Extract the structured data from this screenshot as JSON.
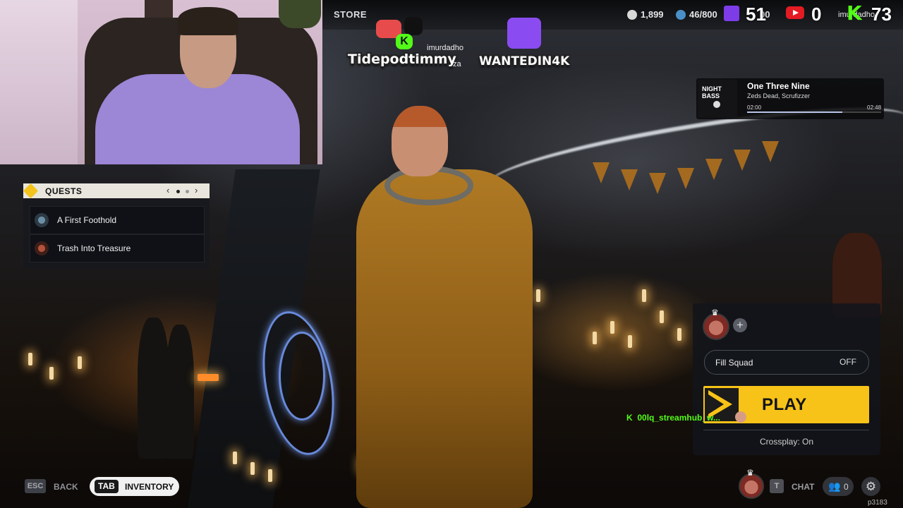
{
  "topbar": {
    "store_label": "STORE",
    "coins": "1,899",
    "capacity": "46/800",
    "hidden_value": "00",
    "twitch_viewers": "51",
    "youtube_viewers": "0",
    "kick_viewers": "73",
    "kick_username": "imurdadho"
  },
  "overlay": {
    "username_left": "Tidepodtimmy",
    "username_mid": "imurdadho",
    "username_mid_tail": "za",
    "username_right": "WANTEDIN4K"
  },
  "music": {
    "album_label": "NIGHT BASS",
    "title": "One Three Nine",
    "artist": "Zeds Dead, Scrufizzer",
    "time_current": "02:00",
    "time_total": "02:48",
    "progress": 0.71
  },
  "quests": {
    "title": "QUESTS",
    "prev": "‹",
    "next": "›",
    "items": [
      {
        "label": "A First Foothold"
      },
      {
        "label": "Trash Into Treasure"
      }
    ]
  },
  "squad": {
    "add_symbol": "+",
    "fill_squad_label": "Fill Squad",
    "fill_squad_value": "OFF",
    "play_label": "PLAY",
    "crossplay_label": "Crossplay: On"
  },
  "chat_overlay": {
    "badge": "K",
    "line": "00lq_streamhub_w..."
  },
  "bottom": {
    "esc_key": "ESC",
    "back_label": "BACK",
    "tab_key": "TAB",
    "inventory_label": "INVENTORY",
    "chat_key": "T",
    "chat_label": "CHAT",
    "friends_count": "0",
    "build_id": "p3183"
  },
  "colors": {
    "accent_yellow": "#f8c318",
    "kick_green": "#53fc18",
    "twitch_purple": "#7d3ce8",
    "youtube_red": "#e31b23"
  }
}
